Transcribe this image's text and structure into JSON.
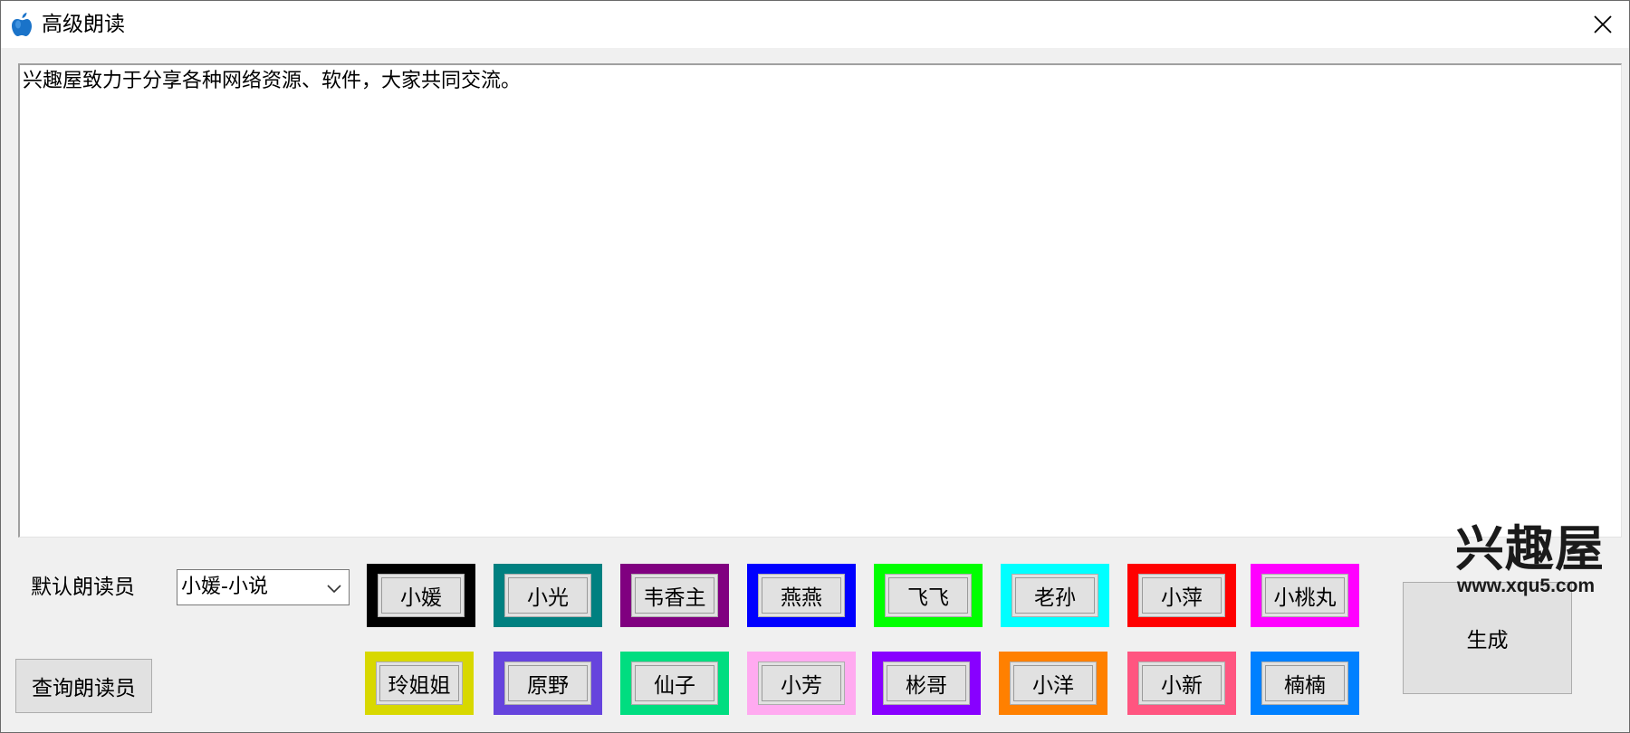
{
  "window": {
    "title": "高级朗读",
    "app_icon": "apple-icon",
    "close_icon": "close-icon"
  },
  "editor": {
    "text": "兴趣屋致力于分享各种网络资源、软件，大家共同交流。"
  },
  "controls": {
    "default_reader_label": "默认朗读员",
    "default_reader_value": "小媛-小说",
    "query_button_label": "查询朗读员",
    "generate_button_label": "生成"
  },
  "voices_row1": [
    {
      "label": "小媛",
      "color": "#000000"
    },
    {
      "label": "小光",
      "color": "#008080"
    },
    {
      "label": "韦香主",
      "color": "#800080"
    },
    {
      "label": "燕燕",
      "color": "#0000ff"
    },
    {
      "label": "飞飞",
      "color": "#00ff00"
    },
    {
      "label": "老孙",
      "color": "#00ffff"
    },
    {
      "label": "小萍",
      "color": "#ff0000"
    },
    {
      "label": "小桃丸",
      "color": "#ff00ff"
    }
  ],
  "voices_row2": [
    {
      "label": "玲姐姐",
      "color": "#d8d800"
    },
    {
      "label": "原野",
      "color": "#6644dd"
    },
    {
      "label": "仙子",
      "color": "#00dd80"
    },
    {
      "label": "小芳",
      "color": "#ffaaf0"
    },
    {
      "label": "彬哥",
      "color": "#8800ff"
    },
    {
      "label": "小洋",
      "color": "#ff8000"
    },
    {
      "label": "小新",
      "color": "#ff5580"
    },
    {
      "label": "楠楠",
      "color": "#0080ff"
    }
  ],
  "watermark": {
    "title": "兴趣屋",
    "url": "www.xqu5.com"
  }
}
